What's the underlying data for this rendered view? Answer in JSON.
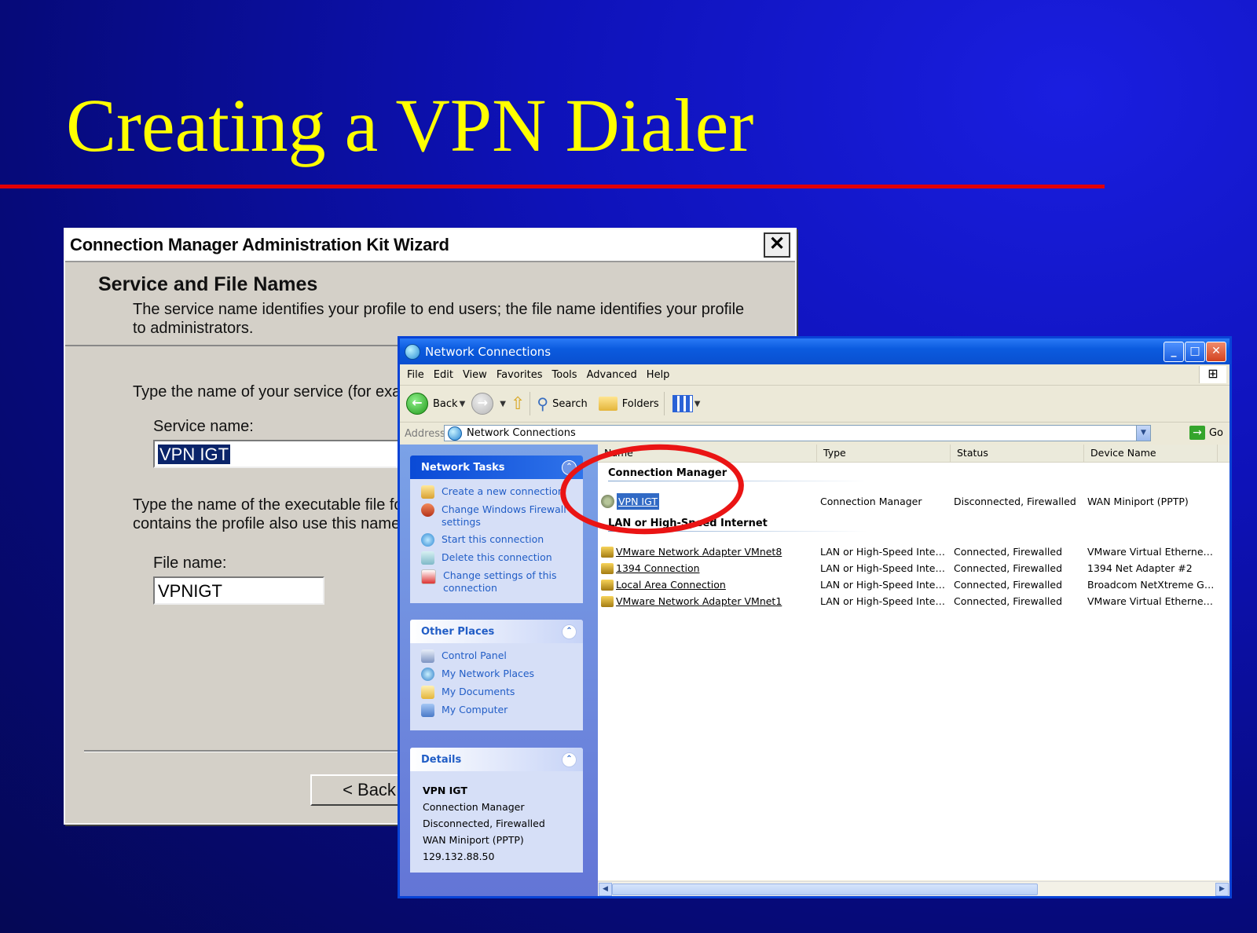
{
  "slide": {
    "title": "Creating a VPN Dialer"
  },
  "wizard": {
    "title": "Connection Manager Administration Kit Wizard",
    "close_glyph": "✕",
    "heading": "Service and File Names",
    "description": "The service name identifies your profile to end users; the file name identifies your profile to administrators.",
    "service_prompt": "Type the name of your service (for exa",
    "service_label": "Service name:",
    "service_value": "VPN IGT",
    "file_prompt_1": "Type the name of the executable file fo",
    "file_prompt_2": "contains the profile also use this name.",
    "file_label": "File name:",
    "file_value": "VPNIGT",
    "back_button": "< Back"
  },
  "network_connections": {
    "title": "Network Connections",
    "menu": [
      "File",
      "Edit",
      "View",
      "Favorites",
      "Tools",
      "Advanced",
      "Help"
    ],
    "toolbar": {
      "back": "Back",
      "search": "Search",
      "folders": "Folders"
    },
    "address": {
      "label": "Address",
      "value": "Network Connections",
      "go": "Go"
    },
    "network_tasks": {
      "header": "Network Tasks",
      "items": [
        "Create a new connection",
        "Change Windows Firewall settings",
        "Start this connection",
        "Delete this connection",
        "Change settings of this connection"
      ]
    },
    "other_places": {
      "header": "Other Places",
      "items": [
        "Control Panel",
        "My Network Places",
        "My Documents",
        "My Computer"
      ]
    },
    "details": {
      "header": "Details",
      "name": "VPN IGT",
      "type": "Connection Manager",
      "status": "Disconnected, Firewalled",
      "device": "WAN Miniport (PPTP)",
      "ip": "129.132.88.50"
    },
    "columns": [
      "Name",
      "Type",
      "Status",
      "Device Name"
    ],
    "groups": [
      {
        "name": "Connection Manager",
        "rows": [
          {
            "name": "VPN IGT",
            "type": "Connection Manager",
            "status": "Disconnected, Firewalled",
            "device": "WAN Miniport (PPTP)"
          }
        ]
      },
      {
        "name": "LAN or High-Speed Internet",
        "rows": [
          {
            "name": "VMware Network Adapter VMnet8",
            "type": "LAN or High-Speed Inter...",
            "status": "Connected, Firewalled",
            "device": "VMware Virtual Ethernet ..."
          },
          {
            "name": "1394 Connection",
            "type": "LAN or High-Speed Inter...",
            "status": "Connected, Firewalled",
            "device": "1394 Net Adapter #2"
          },
          {
            "name": "Local Area Connection",
            "type": "LAN or High-Speed Inter...",
            "status": "Connected, Firewalled",
            "device": "Broadcom NetXtreme Gig..."
          },
          {
            "name": "VMware Network Adapter VMnet1",
            "type": "LAN or High-Speed Inter...",
            "status": "Connected, Firewalled",
            "device": "VMware Virtual Ethernet ..."
          }
        ]
      }
    ]
  },
  "colors": {
    "title": "#ffff00",
    "rule": "#e20000",
    "annotation": "#ea1414"
  }
}
